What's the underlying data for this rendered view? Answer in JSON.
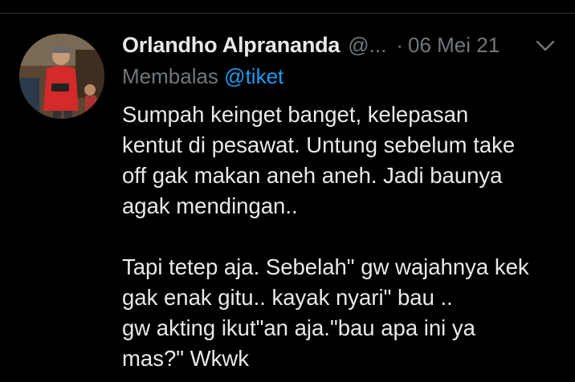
{
  "tweet": {
    "display_name": "Orlandho Alprananda",
    "handle": "@...",
    "separator": "·",
    "date": "06 Mei 21",
    "reply_prefix": "Membalas",
    "reply_mention": "@tiket",
    "body": "Sumpah keinget banget, kelepasan\nkentut di pesawat. Untung sebelum take\noff gak makan aneh aneh. Jadi baunya\nagak mendingan..\n\nTapi tetep aja. Sebelah\" gw wajahnya kek\ngak enak gitu.. kayak nyari\"  bau ..\ngw akting  ikut\"an aja.\"bau apa ini ya\nmas?\" Wkwk"
  },
  "icons": {
    "more": "chevron-down-icon"
  },
  "colors": {
    "background": "#000000",
    "primary_text": "#e7e9ea",
    "secondary_text": "#71767b",
    "link": "#1d9bf0"
  }
}
